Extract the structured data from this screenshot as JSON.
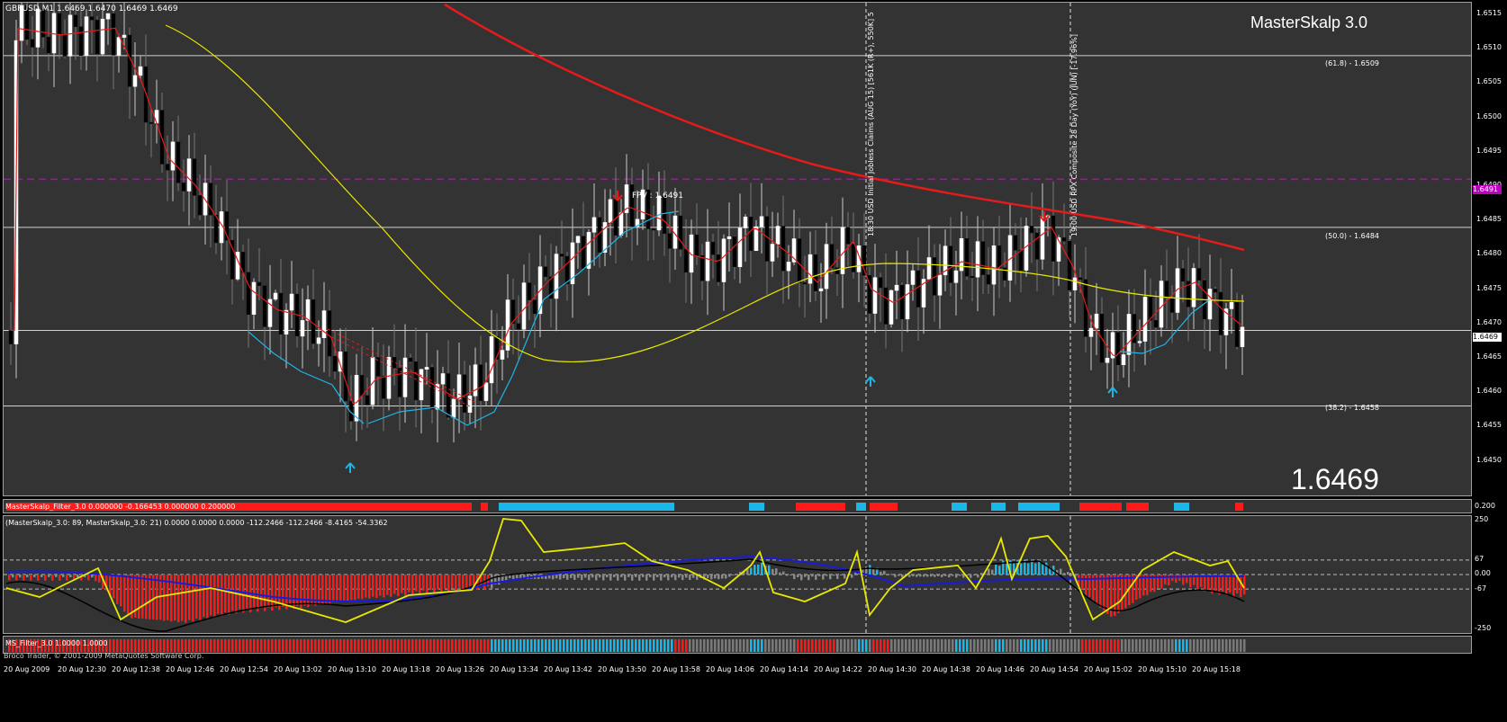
{
  "main_chart": {
    "header": "GBPUSD,M1  1.6469 1.6470 1.6469 1.6469",
    "indicator_title": "MasterSkalp 3.0",
    "big_price": "1.6469",
    "fpv_label": "FPV : 1.6491",
    "fib_labels": [
      "(61.8) -  1.6509",
      "(50.0) -  1.6484",
      "(38.2) -  1.6458"
    ],
    "news_1": "18:30 USD Initial Jobless Claims (AUG 15) [561K (R+), 550K] 5",
    "news_2": "19:00 USD RPX Composite 28 Day (YoY) (JUN) [-17.96%]",
    "price_scale": [
      "1.6515",
      "1.6510",
      "1.6505",
      "1.6500",
      "1.6495",
      "1.6490",
      "1.6485",
      "1.6480",
      "1.6475",
      "1.6470",
      "1.6465",
      "1.6460",
      "1.6455",
      "1.6450"
    ],
    "price_tag_1": "1.6491",
    "price_tag_2": "1.6469"
  },
  "filter_panel": {
    "label": "MasterSkalp_Filter_3.0 0.000000 -0.166453 0.000000 0.200000",
    "scale_top": "0.200"
  },
  "osc_panel": {
    "label": "(MasterSkalp_3.0: 89, MasterSkalp_3.0: 21)  0.0000 0.0000 0.0000 -112.2466 -112.2466 -8.4165 -54.3362",
    "scale": [
      "250",
      "67",
      "0.00",
      "-67",
      "-250"
    ]
  },
  "ms_filter_panel": {
    "label": "MS_Filter_3.0 1.0000 1.0000"
  },
  "copyright": "Broco Trader, © 2001-2009 MetaQuotes Software Corp.",
  "time_axis": [
    "20 Aug 2009",
    "20 Aug 12:30",
    "20 Aug 12:38",
    "20 Aug 12:46",
    "20 Aug 12:54",
    "20 Aug 13:02",
    "20 Aug 13:10",
    "20 Aug 13:18",
    "20 Aug 13:26",
    "20 Aug 13:34",
    "20 Aug 13:42",
    "20 Aug 13:50",
    "20 Aug 13:58",
    "20 Aug 14:06",
    "20 Aug 14:14",
    "20 Aug 14:22",
    "20 Aug 14:30",
    "20 Aug 14:38",
    "20 Aug 14:46",
    "20 Aug 14:54",
    "20 Aug 15:02",
    "20 Aug 15:10",
    "20 Aug 15:18"
  ],
  "colors": {
    "background": "#333333",
    "bull": "#ffffff",
    "bear": "#000000",
    "ema_red": "#e51b1b",
    "sma_yellow": "#e8e800",
    "fast_blue": "#1fb4e6",
    "fpv_magenta": "#c000c0",
    "filter_red": "#ff1a1a",
    "filter_cyan": "#19b8e8"
  }
}
